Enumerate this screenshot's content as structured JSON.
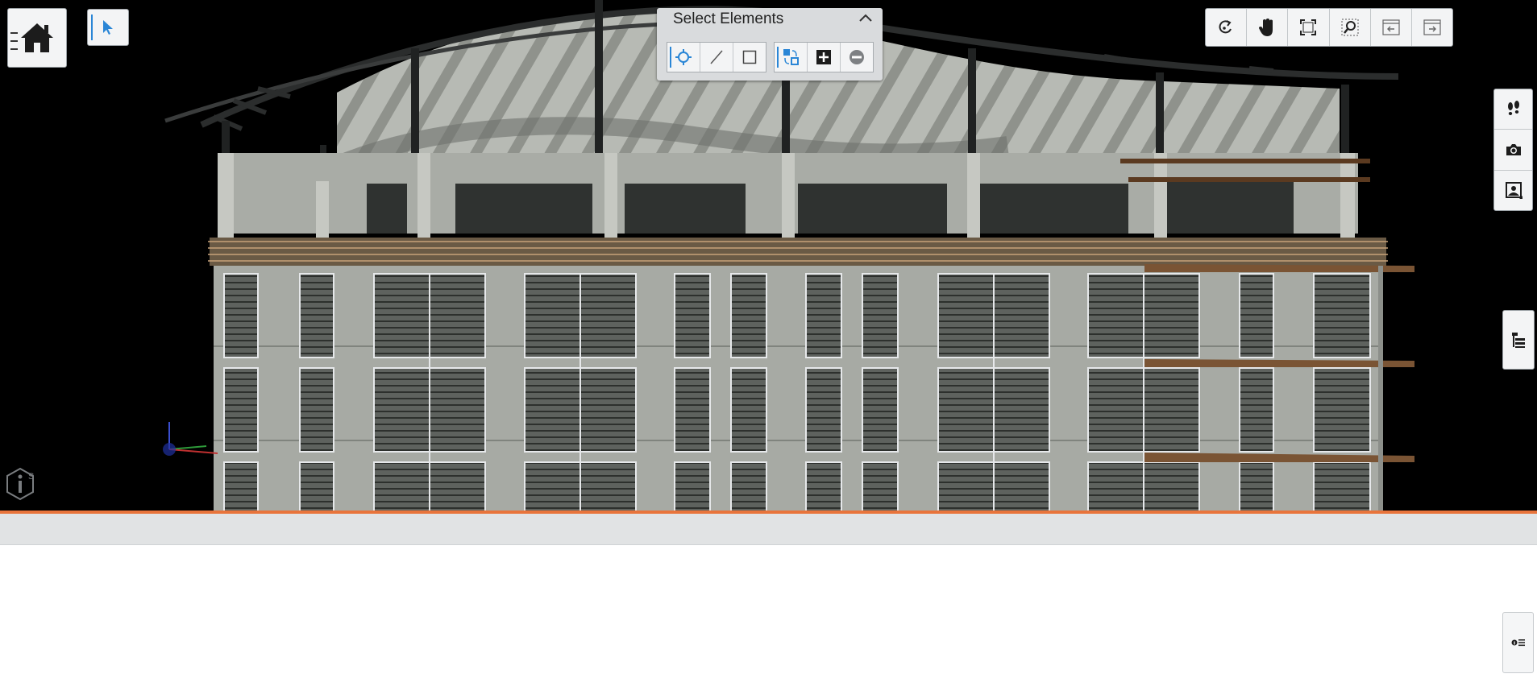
{
  "select_panel": {
    "title": "Select Elements",
    "collapse_icon": "chevron-up-icon",
    "tools": [
      {
        "name": "pick",
        "icon": "crosshair-icon"
      },
      {
        "name": "line",
        "icon": "line-icon"
      },
      {
        "name": "box",
        "icon": "rectangle-icon"
      }
    ],
    "modes": [
      {
        "name": "replace",
        "icon": "replace-selection-icon"
      },
      {
        "name": "add",
        "icon": "plus-box-icon"
      },
      {
        "name": "remove",
        "icon": "minus-circle-icon"
      }
    ]
  },
  "left_toolbar": {
    "home_icon": "home-icon",
    "select_icon": "cursor-arrow-icon"
  },
  "nav_toolbar": [
    "rotate-icon",
    "pan-hand-icon",
    "fit-view-icon",
    "zoom-window-icon",
    "previous-view-icon",
    "next-view-icon"
  ],
  "right_toolbar": [
    "walk-footprints-icon",
    "camera-icon",
    "view-attachments-icon"
  ],
  "model_tree_icon": "model-tree-icon",
  "properties_icon": "properties-list-icon",
  "colors": {
    "accent": "#2a86d6",
    "divider": "#e8743b",
    "panel": "#d9dbdd"
  }
}
